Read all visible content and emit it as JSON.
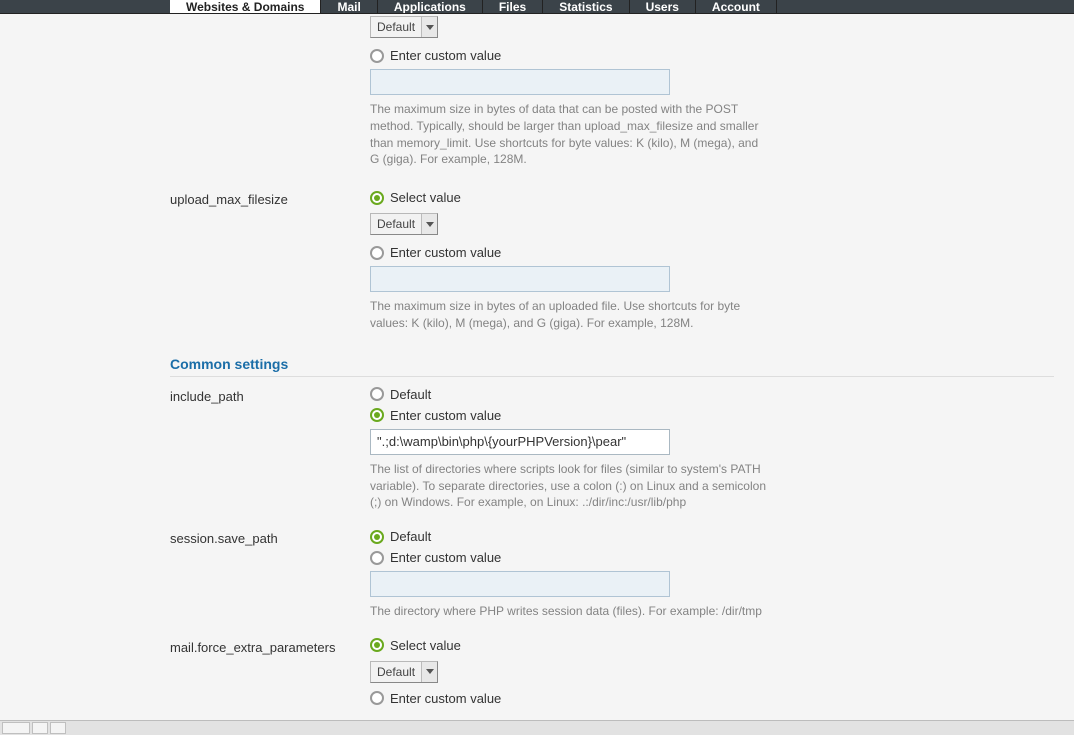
{
  "nav": {
    "tabs": [
      {
        "label": "Websites & Domains",
        "active": true
      },
      {
        "label": "Mail"
      },
      {
        "label": "Applications"
      },
      {
        "label": "Files"
      },
      {
        "label": "Statistics"
      },
      {
        "label": "Users"
      },
      {
        "label": "Account"
      }
    ]
  },
  "labels": {
    "select_value": "Select value",
    "enter_custom": "Enter custom value",
    "default": "Default",
    "default_opt": "Default"
  },
  "settings": {
    "post_max_size": {
      "sel_value": "Default",
      "help": "The maximum size in bytes of data that can be posted with the POST method. Typically, should be larger than upload_max_filesize and smaller than memory_limit. Use shortcuts for byte values: K (kilo), M (mega), and G (giga). For example, 128M."
    },
    "upload_max_filesize": {
      "label": "upload_max_filesize",
      "sel_value": "Default",
      "help": "The maximum size in bytes of an uploaded file. Use shortcuts for byte values: K (kilo), M (mega), and G (giga). For example, 128M."
    },
    "include_path": {
      "label": "include_path",
      "value": "\".;d:\\wamp\\bin\\php\\{yourPHPVersion}\\pear\"",
      "help": "The list of directories where scripts look for files (similar to system's PATH variable). To separate directories, use a colon (:) on Linux and a semicolon (;) on Windows. For example, on Linux: .:/dir/inc:/usr/lib/php"
    },
    "session_save_path": {
      "label": "session.save_path",
      "help": "The directory where PHP writes session data (files). For example: /dir/tmp"
    },
    "mail_force_extra": {
      "label": "mail.force_extra_parameters",
      "sel_value": "Default"
    }
  },
  "sections": {
    "common": "Common settings"
  },
  "bottombar": {
    "text": ""
  }
}
